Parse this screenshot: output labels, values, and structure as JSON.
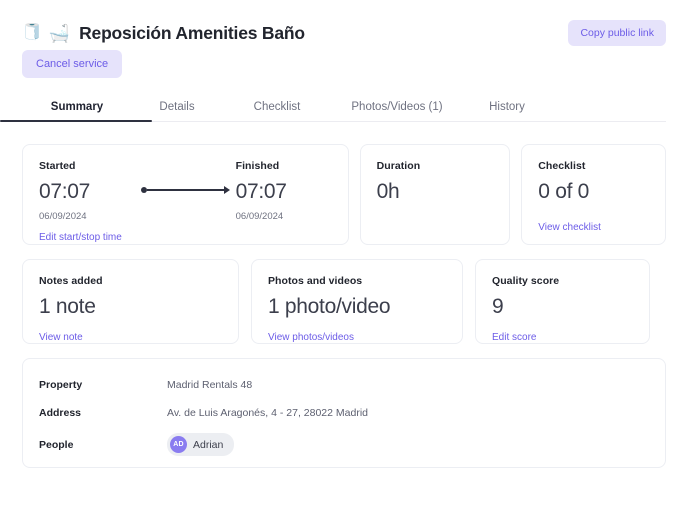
{
  "header": {
    "icons": [
      "toilet-paper-icon",
      "bathtub-icon"
    ],
    "icon_glyphs": {
      "toilet_paper": "🧻",
      "bathtub": "🛁"
    },
    "title": "Reposición Amenities Baño",
    "copy_link_label": "Copy public link",
    "cancel_label": "Cancel service"
  },
  "tabs": [
    {
      "label": "Summary",
      "active": true
    },
    {
      "label": "Details",
      "active": false
    },
    {
      "label": "Checklist",
      "active": false
    },
    {
      "label": "Photos/Videos (1)",
      "active": false
    },
    {
      "label": "History",
      "active": false
    }
  ],
  "cards": {
    "timeline": {
      "started_label": "Started",
      "started_time": "07:07",
      "started_date": "06/09/2024",
      "finished_label": "Finished",
      "finished_time": "07:07",
      "finished_date": "06/09/2024",
      "link": "Edit start/stop time"
    },
    "duration": {
      "label": "Duration",
      "value": "0h"
    },
    "checklist": {
      "label": "Checklist",
      "value": "0 of 0",
      "link": "View checklist"
    },
    "notes": {
      "label": "Notes added",
      "value": "1 note",
      "link": "View note"
    },
    "photos": {
      "label": "Photos and videos",
      "value": "1 photo/video",
      "link": "View photos/videos"
    },
    "quality": {
      "label": "Quality score",
      "value": "9",
      "link": "Edit score"
    }
  },
  "details": {
    "property_label": "Property",
    "property_value": "Madrid Rentals 48",
    "address_label": "Address",
    "address_value": "Av. de Luis Aragonés, 4 - 27, 28022 Madrid",
    "people_label": "People",
    "person": {
      "initials": "AD",
      "name": "Adrian"
    }
  },
  "colors": {
    "accent": "#6c5ce7",
    "accent_soft_bg": "#e6e3fb",
    "avatar_bg": "#8a7cf0",
    "card_border": "#eceef3",
    "tab_active_underline": "#2e3140",
    "text_primary": "#22252e",
    "text_muted": "#6f7281"
  }
}
